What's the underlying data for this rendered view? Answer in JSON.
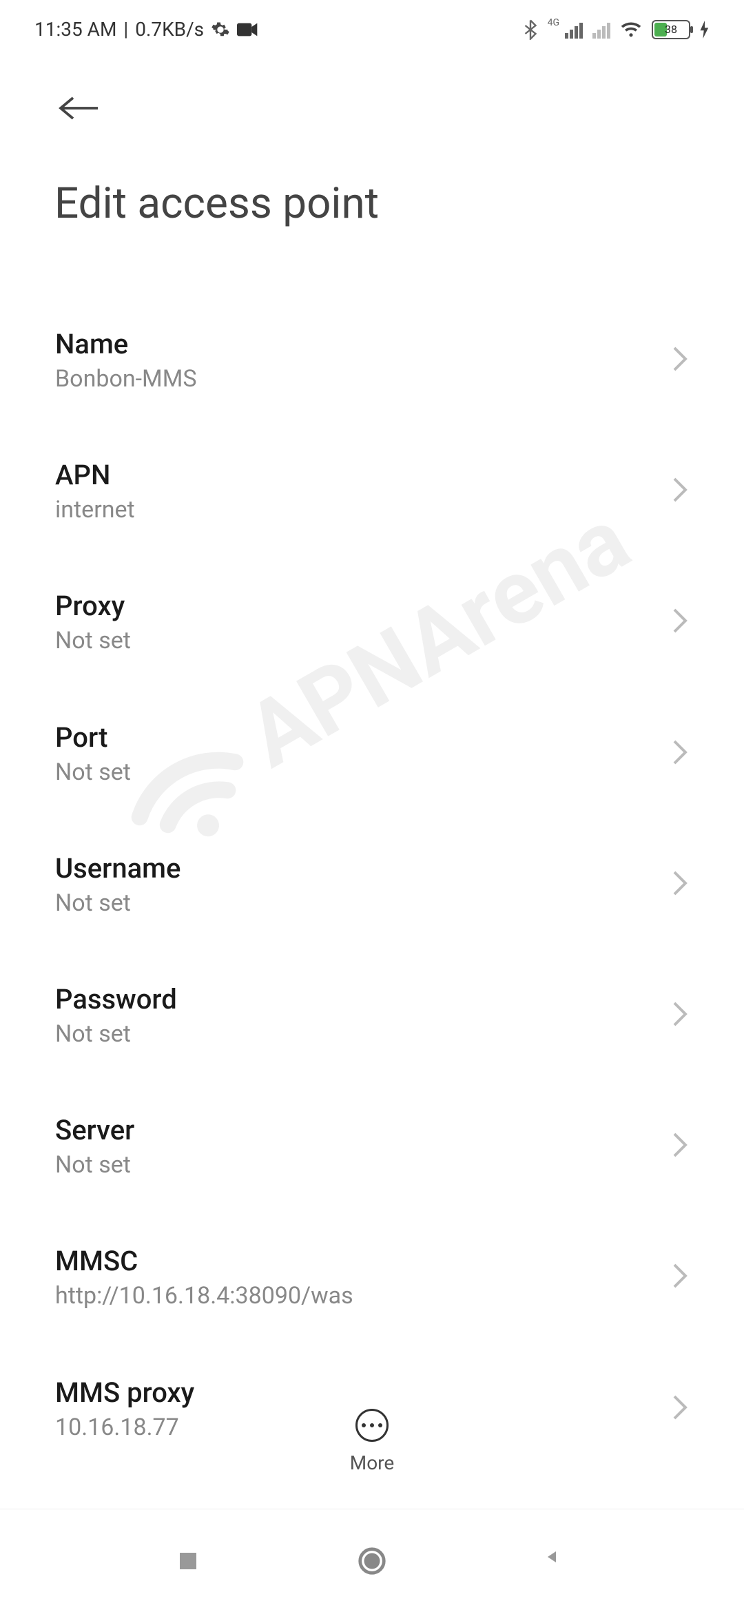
{
  "statusbar": {
    "time": "11:35 AM",
    "speed": "0.7KB/s",
    "network_label": "4G",
    "battery_pct": "38"
  },
  "header": {
    "title": "Edit access point"
  },
  "settings": [
    {
      "label": "Name",
      "value": "Bonbon-MMS"
    },
    {
      "label": "APN",
      "value": "internet"
    },
    {
      "label": "Proxy",
      "value": "Not set"
    },
    {
      "label": "Port",
      "value": "Not set"
    },
    {
      "label": "Username",
      "value": "Not set"
    },
    {
      "label": "Password",
      "value": "Not set"
    },
    {
      "label": "Server",
      "value": "Not set"
    },
    {
      "label": "MMSC",
      "value": "http://10.16.18.4:38090/was"
    },
    {
      "label": "MMS proxy",
      "value": "10.16.18.77"
    }
  ],
  "bottom": {
    "more_label": "More"
  },
  "watermark": {
    "text": "APNArena"
  }
}
